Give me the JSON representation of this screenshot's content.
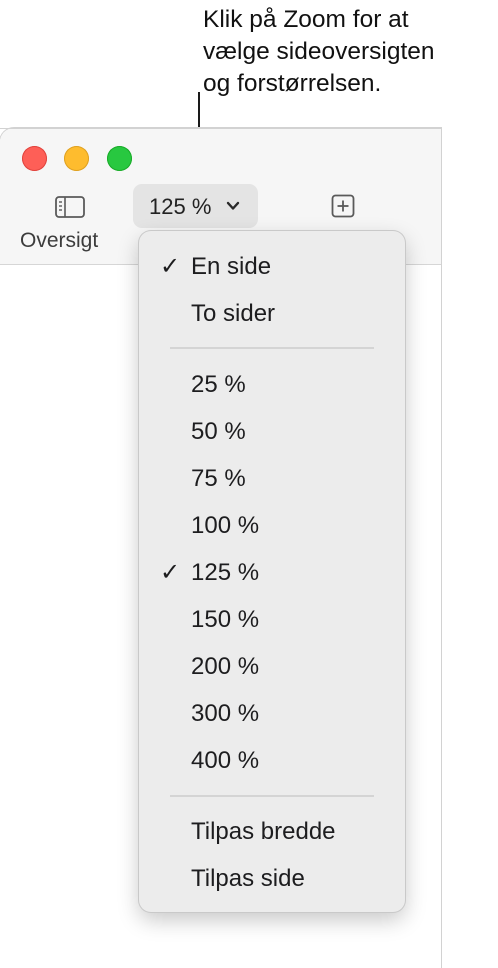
{
  "callout": {
    "lines": [
      "Klik på Zoom for at",
      "vælge sideoversigten",
      "og forstørrelsen."
    ]
  },
  "toolbar": {
    "sidebar_icon": "sidebar-icon",
    "sidebar_label": "Oversigt",
    "zoom_value": "125 %",
    "zoom_icon": "chevron-down-icon",
    "add_icon": "plus-square-icon"
  },
  "menu": {
    "view_items": [
      {
        "label": "En side",
        "checked": true
      },
      {
        "label": "To sider",
        "checked": false
      }
    ],
    "zoom_items": [
      {
        "label": "25 %",
        "checked": false
      },
      {
        "label": "50 %",
        "checked": false
      },
      {
        "label": "75 %",
        "checked": false
      },
      {
        "label": "100 %",
        "checked": false
      },
      {
        "label": "125 %",
        "checked": true
      },
      {
        "label": "150 %",
        "checked": false
      },
      {
        "label": "200 %",
        "checked": false
      },
      {
        "label": "300 %",
        "checked": false
      },
      {
        "label": "400 %",
        "checked": false
      }
    ],
    "fit_items": [
      {
        "label": "Tilpas bredde",
        "checked": false
      },
      {
        "label": "Tilpas side",
        "checked": false
      }
    ],
    "check_glyph": "✓"
  },
  "colors": {
    "close": "#fe5f57",
    "minimize": "#febc2e",
    "maximize": "#28c840"
  }
}
